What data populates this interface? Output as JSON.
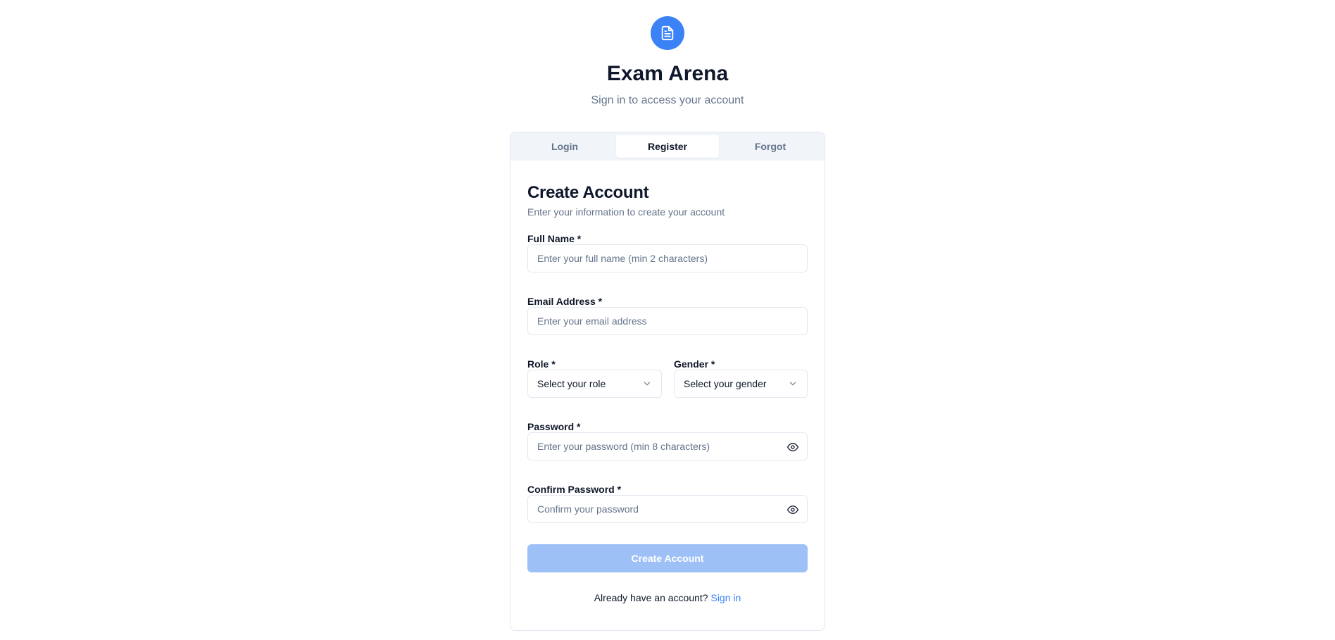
{
  "header": {
    "logo_icon": "document-icon",
    "title": "Exam Arena",
    "subtitle": "Sign in to access your account"
  },
  "tabs": [
    {
      "label": "Login",
      "active": false
    },
    {
      "label": "Register",
      "active": true
    },
    {
      "label": "Forgot",
      "active": false
    }
  ],
  "form": {
    "title": "Create Account",
    "subtitle": "Enter your information to create your account",
    "full_name": {
      "label": "Full Name *",
      "placeholder": "Enter your full name (min 2 characters)",
      "value": ""
    },
    "email": {
      "label": "Email Address *",
      "placeholder": "Enter your email address",
      "value": ""
    },
    "role": {
      "label": "Role *",
      "selected": "Select your role"
    },
    "gender": {
      "label": "Gender *",
      "selected": "Select your gender"
    },
    "password": {
      "label": "Password *",
      "placeholder": "Enter your password (min 8 characters)",
      "value": ""
    },
    "confirm_password": {
      "label": "Confirm Password *",
      "placeholder": "Confirm your password",
      "value": ""
    },
    "submit_label": "Create Account",
    "footer_text": "Already have an account?",
    "footer_link": "Sign in"
  },
  "colors": {
    "accent": "#3b82f6",
    "button_disabled": "#9dc0f7",
    "muted_text": "#64748b",
    "border": "#e2e8f0"
  }
}
